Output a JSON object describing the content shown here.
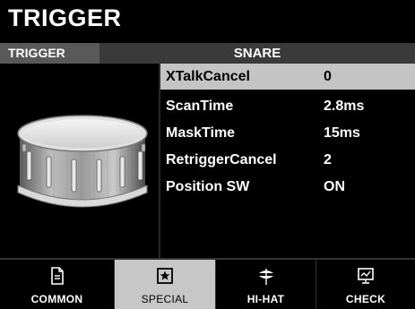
{
  "header": {
    "title": "TRIGGER"
  },
  "subheader": {
    "tag": "TRIGGER",
    "instrument": "SNARE"
  },
  "params": [
    {
      "name": "XTalkCancel",
      "value": "0",
      "selected": true
    },
    {
      "name": "ScanTime",
      "value": "2.8ms",
      "selected": false
    },
    {
      "name": "MaskTime",
      "value": "15ms",
      "selected": false
    },
    {
      "name": "RetriggerCancel",
      "value": "2",
      "selected": false
    },
    {
      "name": "Position SW",
      "value": "ON",
      "selected": false
    }
  ],
  "tabs": [
    {
      "label": "COMMON",
      "icon": "document-icon",
      "active": false
    },
    {
      "label": "SPECIAL",
      "icon": "star-icon",
      "active": true
    },
    {
      "label": "HI-HAT",
      "icon": "hi-hat-icon",
      "active": false
    },
    {
      "label": "CHECK",
      "icon": "monitor-check-icon",
      "active": false
    }
  ],
  "colors": {
    "background": "#000000",
    "selected_row": "#c4c4c4",
    "active_tab": "#c7c7c7",
    "subbar": "#3a3a3a",
    "tag_bg": "#595959"
  }
}
